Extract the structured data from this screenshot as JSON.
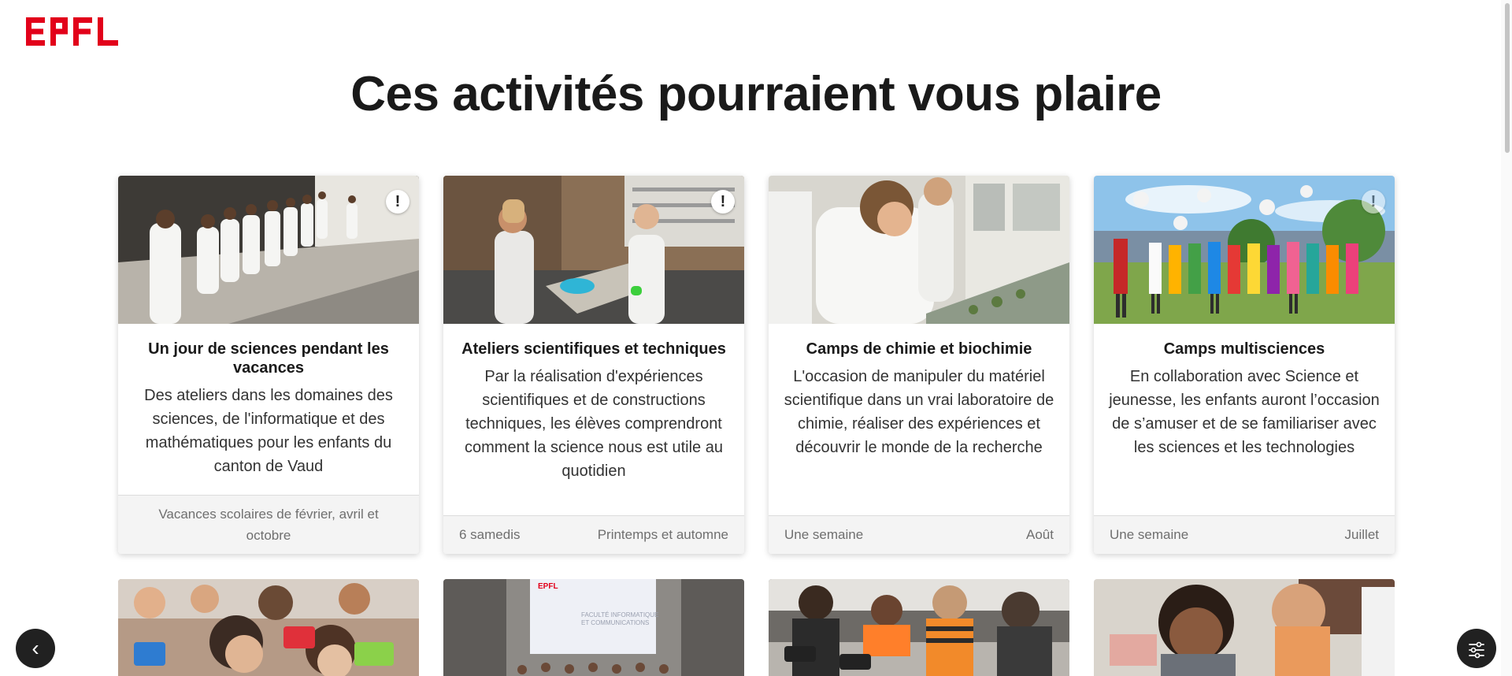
{
  "brand": {
    "logo_text": "EPFL",
    "accent": "#e2001a"
  },
  "page": {
    "title": "Ces activités pourraient vous plaire"
  },
  "cards": [
    {
      "title": "Un jour de sciences pendant les vacances",
      "description": "Des ateliers dans les domaines des sciences, de l'informatique et des mathématiques pour les enfants du canton de Vaud",
      "footer_left": "Vacances scolaires de février, avril et octobre",
      "footer_right": "",
      "badge": "!",
      "image": "children-lab-coats-terrace"
    },
    {
      "title": "Ateliers scientifiques et techniques",
      "description": "Par la réalisation d'expériences scientifiques et de constructions techniques, les élèves comprendront comment la science nous est utile au quotidien",
      "footer_left": "6 samedis",
      "footer_right": "Printemps et automne",
      "badge": "!",
      "image": "two-girls-experiment"
    },
    {
      "title": "Camps de chimie et biochimie",
      "description": "L'occasion de manipuler du matériel scientifique dans un vrai laboratoire de chimie, réaliser des expériences et découvrir le monde de la recherche",
      "footer_left": "Une semaine",
      "footer_right": "Août",
      "badge": "",
      "image": "chemistry-lab"
    },
    {
      "title": "Camps multisciences",
      "description": "En collaboration avec Science et jeunesse, les enfants auront l’occasion de s’amuser et de se familiariser avec les sciences et les technologies",
      "footer_left": "Une semaine",
      "footer_right": "Juillet",
      "badge": "!",
      "image": "kids-throwing-coats-field"
    }
  ],
  "row2_images": [
    "classroom-tablets",
    "auditorium-group",
    "robotics-kids",
    "girls-lab-smiling"
  ],
  "row2_slide_text": "FACULTÉ INFORMATIQUE ET COMMUNICATIONS",
  "controls": {
    "prev_icon": "‹",
    "filter_icon": "sliders-icon"
  }
}
